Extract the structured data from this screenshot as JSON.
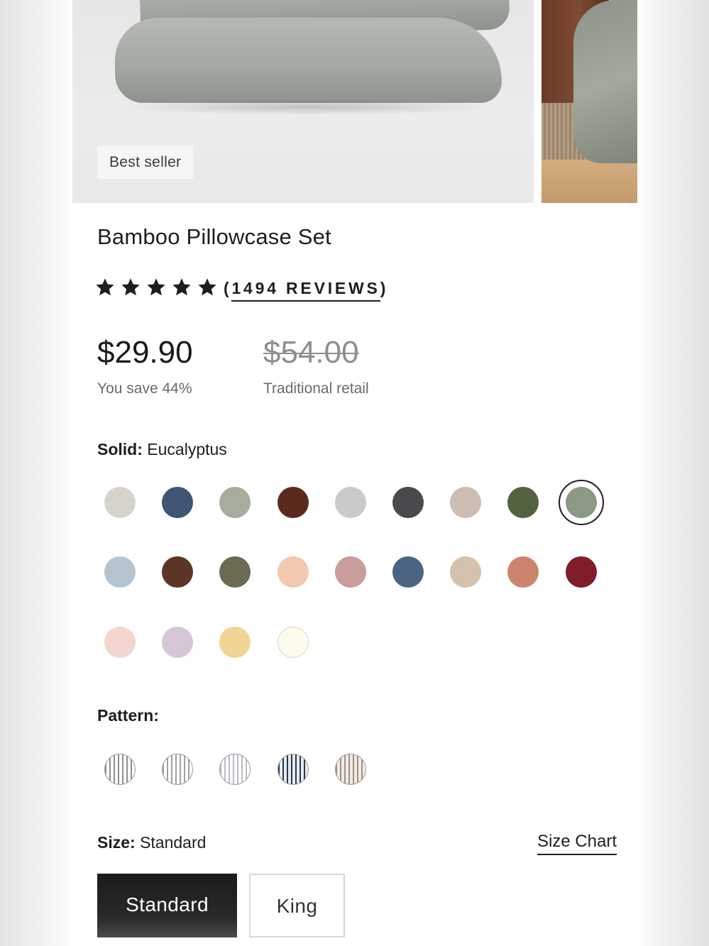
{
  "product": {
    "badge": "Best seller",
    "title": "Bamboo Pillowcase Set",
    "rating_stars": 5,
    "reviews_open": "(",
    "reviews_text": "1494 REVIEWS",
    "reviews_close": ")",
    "price": "$29.90",
    "save_text": "You save 44%",
    "old_price": "$54.00",
    "old_price_label": "Traditional retail"
  },
  "solid": {
    "label": "Solid:",
    "selected": "Eucalyptus",
    "swatches": [
      {
        "color": "#d6d3cb"
      },
      {
        "color": "#3f5574"
      },
      {
        "color": "#a7ad9c"
      },
      {
        "color": "#5a2a1c"
      },
      {
        "color": "#c8cacc"
      },
      {
        "color": "#49494e"
      },
      {
        "color": "#cbbdb1"
      },
      {
        "color": "#53623f"
      },
      {
        "color": "#8e9985",
        "selected": true
      },
      {
        "color": "#b6c4cf"
      },
      {
        "color": "#5c3527"
      },
      {
        "color": "#6d6a53"
      },
      {
        "color": "#f2c8ae"
      },
      {
        "color": "#c99d99"
      },
      {
        "color": "#4c6484"
      },
      {
        "color": "#d5c1ae"
      },
      {
        "color": "#cd846d"
      },
      {
        "color": "#7f1d28"
      },
      {
        "color": "#f2d6cd"
      },
      {
        "color": "#d6c6d6"
      },
      {
        "color": "#f0d595"
      },
      {
        "color": "#fcfbec"
      }
    ]
  },
  "pattern": {
    "label": "Pattern:",
    "swatches": [
      {
        "stripe": "#8e8e8e",
        "base": "#ffffff"
      },
      {
        "stripe": "#a0a0a0",
        "base": "#ffffff"
      },
      {
        "stripe": "#b9bdc6",
        "base": "#ffffff"
      },
      {
        "stripe": "#27384f",
        "base": "#e8ecef"
      },
      {
        "stripe": "#a28f83",
        "base": "#f1ebe6"
      }
    ]
  },
  "size": {
    "label": "Size:",
    "selected": "Standard",
    "chart_link": "Size Chart",
    "options": [
      "Standard",
      "King"
    ]
  },
  "icons": {
    "star": "star-icon"
  }
}
